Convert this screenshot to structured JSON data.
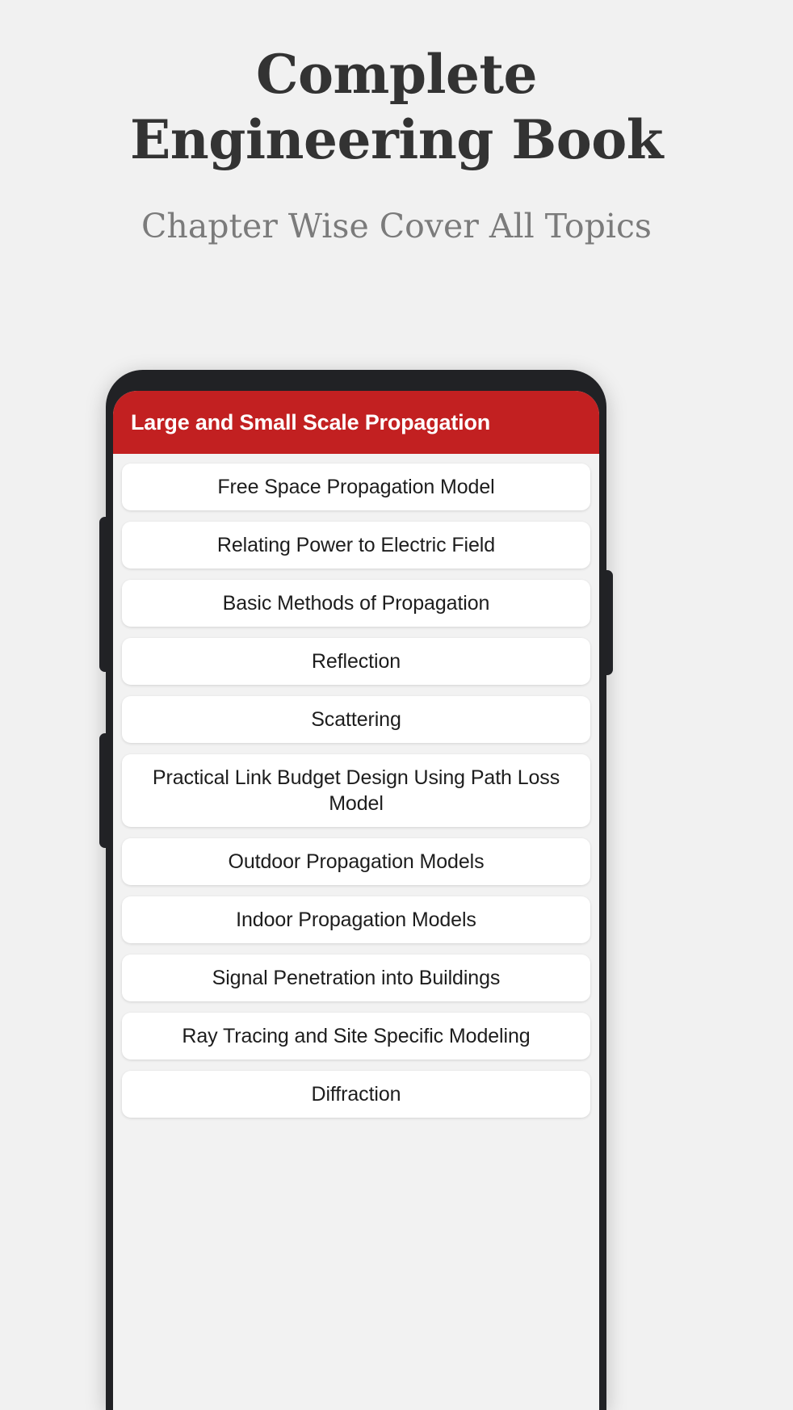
{
  "promo": {
    "title_line1": "Complete",
    "title_line2": "Engineering Book",
    "subtitle": "Chapter Wise Cover All Topics"
  },
  "colors": {
    "page_background": "#f1f1f1",
    "app_bar": "#c22021",
    "phone_frame": "#212225",
    "card": "#ffffff",
    "screen_background": "#f2f2f2",
    "title_text": "#333333",
    "subtitle_text": "#7b7b7b",
    "card_text": "#1d1d1d"
  },
  "phone": {
    "app_bar": {
      "title": "Large and Small Scale Propagation"
    },
    "topics": [
      {
        "label": "Free Space Propagation Model"
      },
      {
        "label": "Relating Power to Electric Field"
      },
      {
        "label": "Basic Methods of Propagation"
      },
      {
        "label": "Reflection"
      },
      {
        "label": "Scattering"
      },
      {
        "label": "Practical Link Budget Design Using Path Loss Model"
      },
      {
        "label": "Outdoor Propagation Models"
      },
      {
        "label": "Indoor Propagation Models"
      },
      {
        "label": "Signal Penetration into Buildings"
      },
      {
        "label": "Ray Tracing and Site Specific Modeling"
      },
      {
        "label": "Diffraction"
      }
    ],
    "hardware_buttons": [
      {
        "name": "volume-rocker"
      },
      {
        "name": "silent-switch"
      },
      {
        "name": "power-button"
      }
    ]
  }
}
